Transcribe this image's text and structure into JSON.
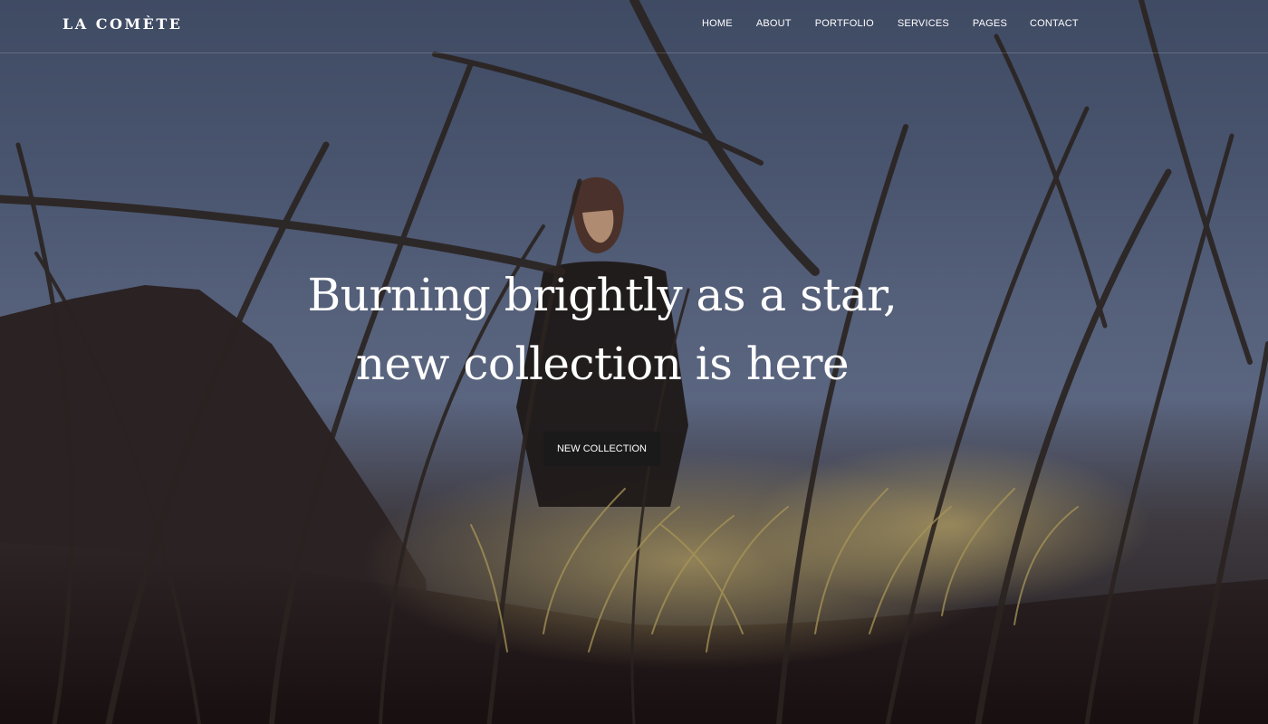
{
  "header": {
    "logo": "LA COMÈTE",
    "nav": {
      "home": "HOME",
      "about": "ABOUT",
      "portfolio": "PORTFOLIO",
      "services": "SERVICES",
      "pages": "PAGES",
      "contact": "CONTACT"
    }
  },
  "hero": {
    "headline_line1": "Burning brightly as a star,",
    "headline_line2": "new collection is here",
    "cta_label": "NEW COLLECTION"
  }
}
